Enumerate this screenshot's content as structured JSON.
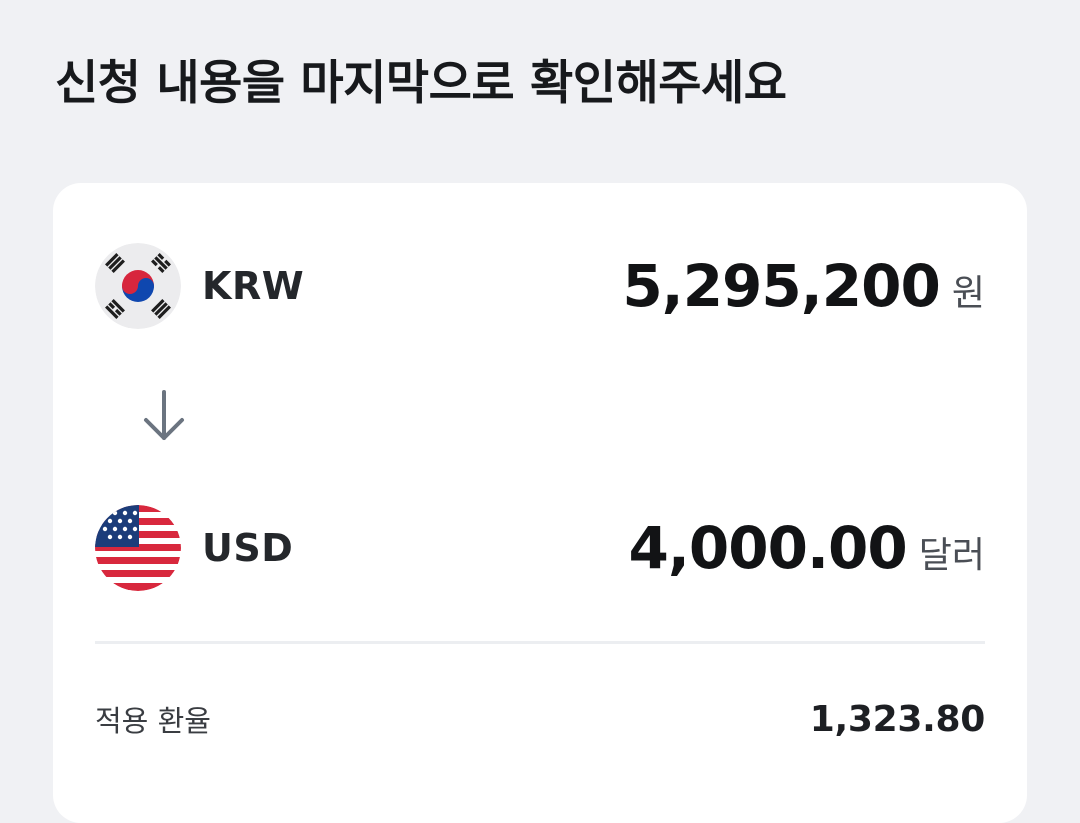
{
  "page": {
    "title": "신청 내용을 마지막으로 확인해주세요"
  },
  "exchange": {
    "from": {
      "currency": "KRW",
      "flag_icon": "south-korea-flag-icon",
      "amount": "5,295,200",
      "unit": "원"
    },
    "direction_icon": "arrow-down-icon",
    "to": {
      "currency": "USD",
      "flag_icon": "united-states-flag-icon",
      "amount": "4,000.00",
      "unit": "달러"
    },
    "rate": {
      "label": "적용 환율",
      "value": "1,323.80"
    }
  },
  "colors": {
    "background": "#f0f1f4",
    "card": "#ffffff",
    "text_primary": "#121315",
    "arrow": "#6b7480"
  }
}
